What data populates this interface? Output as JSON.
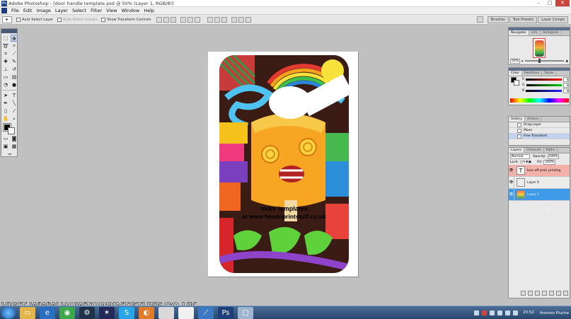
{
  "window": {
    "title": "Adobe Photoshop - [door handle template.psd @ 50% (Layer 1, RGB/8)]",
    "controls": [
      "–",
      "□",
      "✕"
    ]
  },
  "menu": [
    "File",
    "Edit",
    "Image",
    "Layer",
    "Select",
    "Filter",
    "View",
    "Window",
    "Help"
  ],
  "options_bar": {
    "auto_select_label": "Auto Select Layer",
    "auto_select_group_label": "Auto Select Groups",
    "show_transform_label": "Show Transform Controls",
    "wells": [
      "Brushes",
      "Tool Presets",
      "Layer Comps"
    ]
  },
  "document": {
    "caption_line1": "more templates",
    "caption_line2": "at www.howtoprintstuff.co.uk"
  },
  "navigator": {
    "tabs": [
      "Navigator",
      "Info",
      "Histogram"
    ],
    "zoom": "50%"
  },
  "color_panel": {
    "tabs": [
      "Color",
      "Swatches",
      "Styles"
    ],
    "channels": [
      {
        "label": "R",
        "value": "0",
        "color": "#e02020"
      },
      {
        "label": "G",
        "value": "0",
        "color": "#20a020"
      },
      {
        "label": "B",
        "value": "0",
        "color": "#2030d0"
      }
    ]
  },
  "history_panel": {
    "tabs": [
      "History",
      "Actions"
    ],
    "items": [
      "Drag Layer",
      "Move",
      "Free Transform"
    ]
  },
  "layers_panel": {
    "tabs": [
      "Layers",
      "Channels",
      "Paths"
    ],
    "blend_mode": "Normal",
    "opacity_label": "Opacity:",
    "opacity": "100%",
    "lock_label": "Lock:",
    "fill_label": "Fill:",
    "fill": "100%",
    "layers": [
      {
        "name": "turn off prior printing",
        "kind": "text",
        "thumb": "T"
      },
      {
        "name": "Layer 0",
        "kind": "checker",
        "thumb": ""
      },
      {
        "name": "Layer 1",
        "kind": "image",
        "thumb": ""
      }
    ]
  },
  "watermark": "VISIT WWW.HOWTOPRINTSTUFF.CO.UK",
  "taskbar": {
    "clock_time": "20:52",
    "user": "Antonio Pluche",
    "apps": [
      "explorer-icon",
      "ie-icon",
      "chrome-icon",
      "steam-icon",
      "galaxy-icon",
      "skype-icon",
      "firefox-icon",
      "notepad-icon",
      "file-icon",
      "feather-icon",
      "photoshop-icon",
      "window-icon"
    ]
  },
  "colors": {
    "selected_layer": "#3f9bea",
    "text_layer": "#f3b0a9",
    "taskbar": "#29476e"
  }
}
